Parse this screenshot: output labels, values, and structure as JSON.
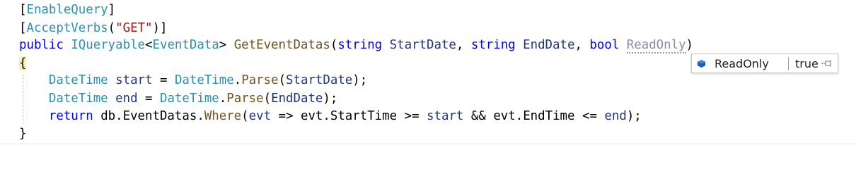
{
  "code": {
    "line1": {
      "open": "[",
      "attr": "EnableQuery",
      "close": "]"
    },
    "line2": {
      "open": "[",
      "attr": "AcceptVerbs",
      "paren_open": "(",
      "str": "\"GET\"",
      "paren_close": ")]"
    },
    "line3": {
      "kw_public": "public",
      "type_iq": "IQueryable",
      "lt": "<",
      "type_ed": "EventData",
      "gt": ">",
      "method": "GetEventDatas",
      "paren_open": "(",
      "kw_string1": "string",
      "param1": "StartDate",
      "comma1": ",",
      "kw_string2": "string",
      "param2": "EndDate",
      "comma2": ",",
      "kw_bool": "bool",
      "param3": "ReadOnly",
      "paren_close": ")"
    },
    "line4": {
      "brace": "{"
    },
    "line5": {
      "type": "DateTime",
      "var": "start",
      "eq": "=",
      "type2": "DateTime",
      "dot": ".",
      "method": "Parse",
      "po": "(",
      "arg": "StartDate",
      "pc": ");"
    },
    "line6": {
      "type": "DateTime",
      "var": "end",
      "eq": "=",
      "type2": "DateTime",
      "dot": ".",
      "method": "Parse",
      "po": "(",
      "arg": "EndDate",
      "pc": ");"
    },
    "line7": {
      "kw_return": "return",
      "db": "db.EventDatas.",
      "method": "Where",
      "po": "(",
      "evt": "evt",
      "arrow": "=>",
      "evt2": "evt.StartTime",
      "ge": ">=",
      "start": "start",
      "and": "&&",
      "evt3": "evt.EndTime",
      "le": "<=",
      "end": "end",
      "pc": ");"
    },
    "line8": {
      "brace": "}"
    }
  },
  "debug_hint": {
    "name": "ReadOnly",
    "value": "true",
    "icon": "cube-icon",
    "pin_icon": "pin-icon"
  }
}
